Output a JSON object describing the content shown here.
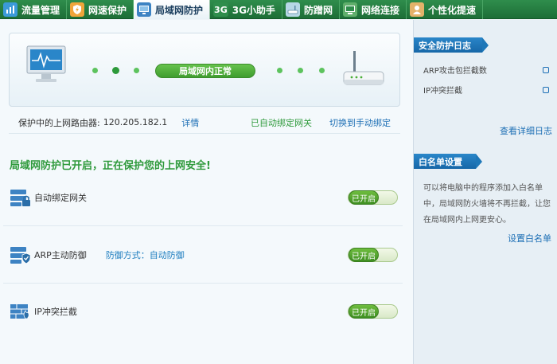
{
  "tabs": [
    {
      "label": "流量管理",
      "icon": "traffic-icon",
      "color": "#3b9ad9"
    },
    {
      "label": "网速保护",
      "icon": "speed-shield-icon",
      "color": "#f0a53a"
    },
    {
      "label": "局域网防护",
      "icon": "lan-shield-icon",
      "color": "#3d83c3",
      "active": true
    },
    {
      "label": "3G小助手",
      "icon": "3g-icon",
      "glyph": "3G",
      "color": "#2f8d4c"
    },
    {
      "label": "防蹭网",
      "icon": "router-icon",
      "color": "#b7d7e6"
    },
    {
      "label": "网络连接",
      "icon": "network-icon",
      "color": "#5fae6b"
    },
    {
      "label": "个性化提速",
      "icon": "person-icon",
      "color": "#e4b26a"
    }
  ],
  "status": {
    "label": "局域网内正常",
    "color": "#4aae36"
  },
  "router_bar": {
    "label": "保护中的上网路由器:",
    "ip": "120.205.182.1",
    "detail_link": "详情",
    "bound_text": "已自动绑定网关",
    "switch_link": "切换到手动绑定"
  },
  "headline": "局域网防护已开启，正在保护您的上网安全!",
  "features": [
    {
      "name": "自动绑定网关",
      "mode": "",
      "toggle": "已开启",
      "icon": "server-lock-icon"
    },
    {
      "name": "ARP主动防御",
      "mode": "防御方式：自动防御",
      "toggle": "已开启",
      "icon": "server-shield-icon"
    },
    {
      "name": "IP冲突拦截",
      "mode": "",
      "toggle": "已开启",
      "icon": "firewall-icon"
    }
  ],
  "side": {
    "log_title": "安全防护日志",
    "log_items": [
      "ARP攻击包拦截数",
      "IP冲突拦截"
    ],
    "log_link": "查看详细日志",
    "whitelist_title": "白名单设置",
    "whitelist_desc": "可以将电脑中的程序添加入白名单中，局域网防火墙将不再拦截，让您在局域网内上网更安心。",
    "whitelist_link": "设置白名单"
  }
}
